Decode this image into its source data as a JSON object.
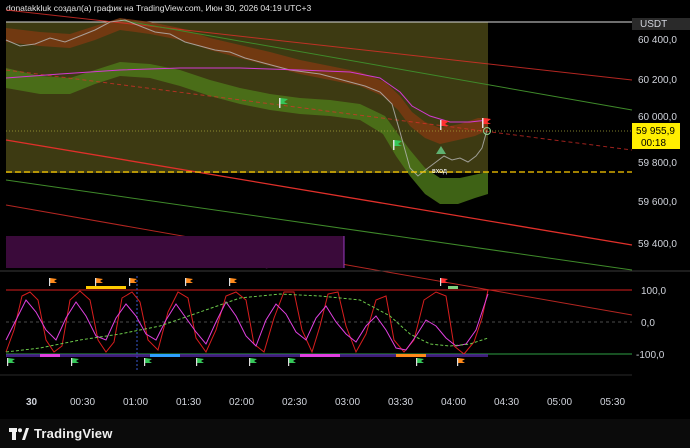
{
  "header": {
    "caption": "donatakkluk создал(а) график на TradingView.com, Июн 30, 2026 04:19 UTC+3"
  },
  "price_axis": {
    "currency": "USDT",
    "labels": [
      "60 400,0",
      "60 200,0",
      "60 000,0",
      "59 800,0",
      "59 600,0",
      "59 400,0"
    ],
    "current_price": "59 955,9",
    "countdown": "00:18"
  },
  "oscillator_axis": {
    "labels": [
      "100,0",
      "0,0",
      "-100,0"
    ]
  },
  "time_axis": {
    "labels": [
      "30",
      "00:30",
      "01:00",
      "01:30",
      "02:00",
      "02:30",
      "03:00",
      "03:30",
      "04:00",
      "04:30",
      "05:00",
      "05:30"
    ]
  },
  "annotations": {
    "entry_label": "вход"
  },
  "footer": {
    "brand": "TradingView"
  },
  "colors": {
    "background": "#000000",
    "shade_olive": "#3d3a12",
    "upper_band": "#7a3a12",
    "lower_band": "#4e7a1a",
    "bear_flag": "#ff3030",
    "bull_flag": "#35c759",
    "price_tag": "#ffee00",
    "channel_red": "#e0302a",
    "oscillator_pink": "#e040e0",
    "oscillator_red": "#d81e1e"
  }
}
